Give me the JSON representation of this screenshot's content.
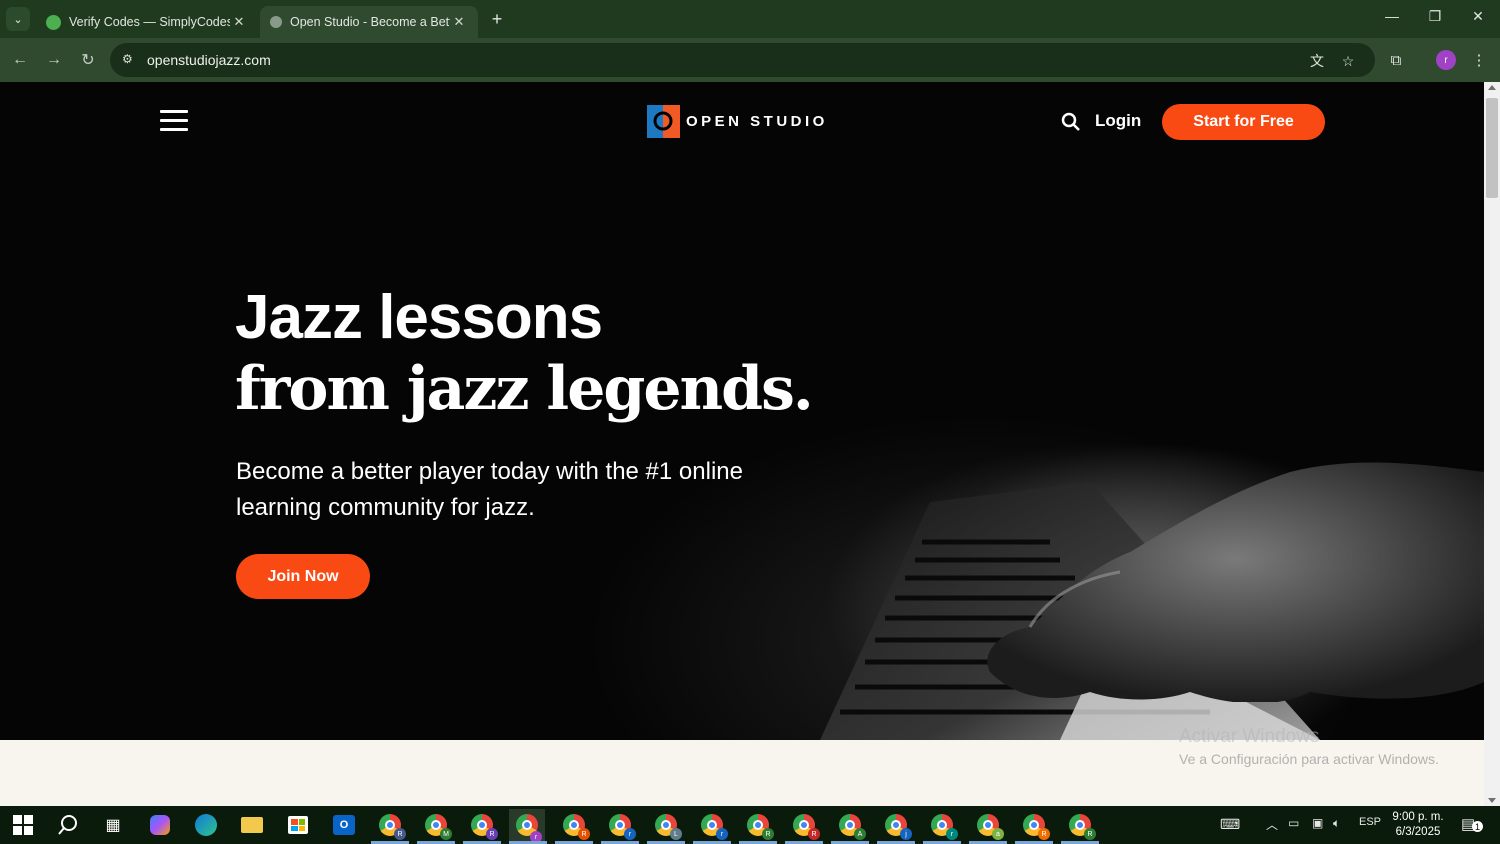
{
  "browser": {
    "tabs": [
      {
        "label": "Verify Codes — SimplyCodes",
        "active": false
      },
      {
        "label": "Open Studio - Become a Better",
        "active": true
      }
    ],
    "url": "openstudiojazz.com"
  },
  "site": {
    "logo_text": "OPEN STUDIO",
    "login_label": "Login",
    "cta_label": "Start for Free",
    "hero": {
      "headline_line1": "Jazz lessons",
      "headline_line2": "from jazz legends.",
      "subtitle": "Become a better player today with the #1 online learning community for jazz.",
      "join_label": "Join Now"
    }
  },
  "os": {
    "watermark_title": "Activar Windows",
    "watermark_sub": "Ve a Configuración para activar Windows.",
    "language": "ESP",
    "time": "9:00 p. m.",
    "date": "6/3/2025",
    "notification_count": "1",
    "taskbar_chrome_badges": [
      "R",
      "M",
      "R",
      "r",
      "R",
      "r",
      "L",
      "r",
      "R",
      "R",
      "A",
      "j",
      "r",
      "a",
      "R",
      "R"
    ]
  },
  "colors": {
    "accent": "#fa4a14",
    "chrome_frame": "#1f3a1f",
    "chrome_toolbar": "#2f4a2f",
    "bottom_band": "#f8f5ee"
  }
}
